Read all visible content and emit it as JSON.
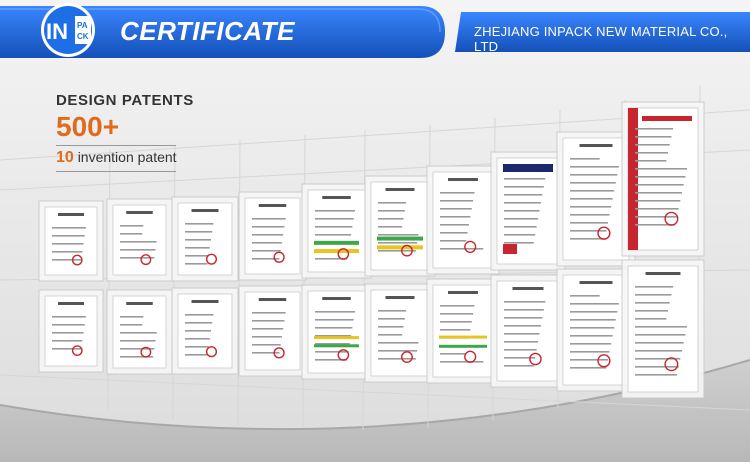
{
  "header": {
    "title": "CERTIFICATE",
    "logo_text": "INPACK",
    "company": "ZHEJIANG INPACK NEW MATERIAL CO., LTD"
  },
  "stats": {
    "heading": "DESIGN PATENTS",
    "count": "500+",
    "invention_number": "10",
    "invention_label": "invention patent"
  },
  "colors": {
    "header_blue": "#1a5fd0",
    "accent_orange": "#e06b1c",
    "certificate_red": "#c8262e"
  }
}
